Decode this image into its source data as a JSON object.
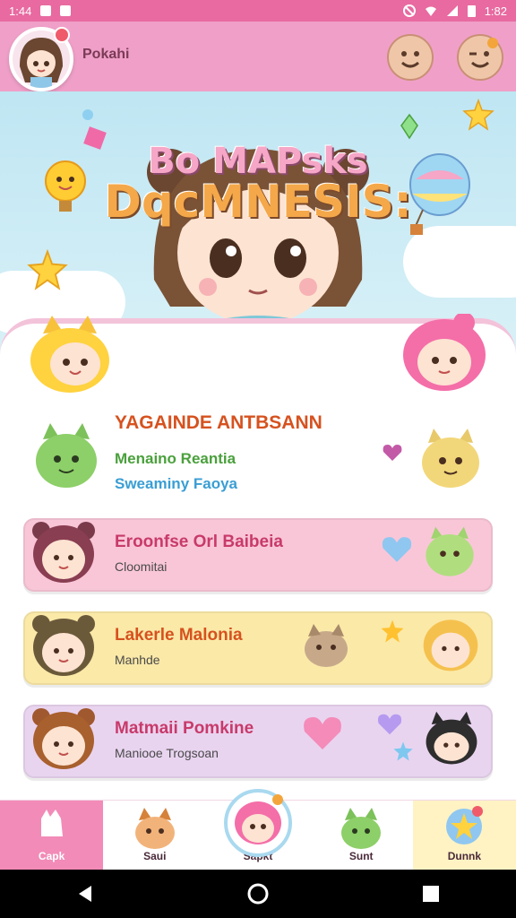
{
  "status_bar": {
    "time_left": "1:44",
    "time_right": "1:82"
  },
  "header": {
    "username": "Pokahi"
  },
  "scene": {
    "title_line1": "Bo MAPsks",
    "title_line2": "DqcMNESIS:"
  },
  "featured": {
    "title": "YAGAINDE ANTBSANN",
    "subtitle1": "Menaino Reantia",
    "subtitle2": "Sweaminy Faoya"
  },
  "list": [
    {
      "title": "Eroonfse Orl Baibeia",
      "subtitle": "Cloomitai",
      "icon": "heart-icon",
      "bg": "#f9c6d8",
      "title_color": "#c83a6a"
    },
    {
      "title": "Lakerle Malonia",
      "subtitle": "Manhde",
      "icon": "heart-icon",
      "bg": "#fbe9a8",
      "title_color": "#d6521f"
    },
    {
      "title": "Matmaii Pomkine",
      "subtitle": "Maniooe Trogsoan",
      "icon": "heart-icon",
      "bg": "#e9d4f0",
      "title_color": "#c83a6a"
    }
  ],
  "bottom_nav": [
    {
      "label": "Capk",
      "icon": "heart-icon"
    },
    {
      "label": "Saui",
      "icon": "cat-icon"
    },
    {
      "label": "Sapkt",
      "icon": "pink-cat-icon"
    },
    {
      "label": "Sunt",
      "icon": "green-cat-icon"
    },
    {
      "label": "Dunnk",
      "icon": "star-icon"
    }
  ],
  "colors": {
    "brand": "#f28bb8",
    "sky": "#bfe6f3",
    "accent_orange": "#d6521f"
  }
}
